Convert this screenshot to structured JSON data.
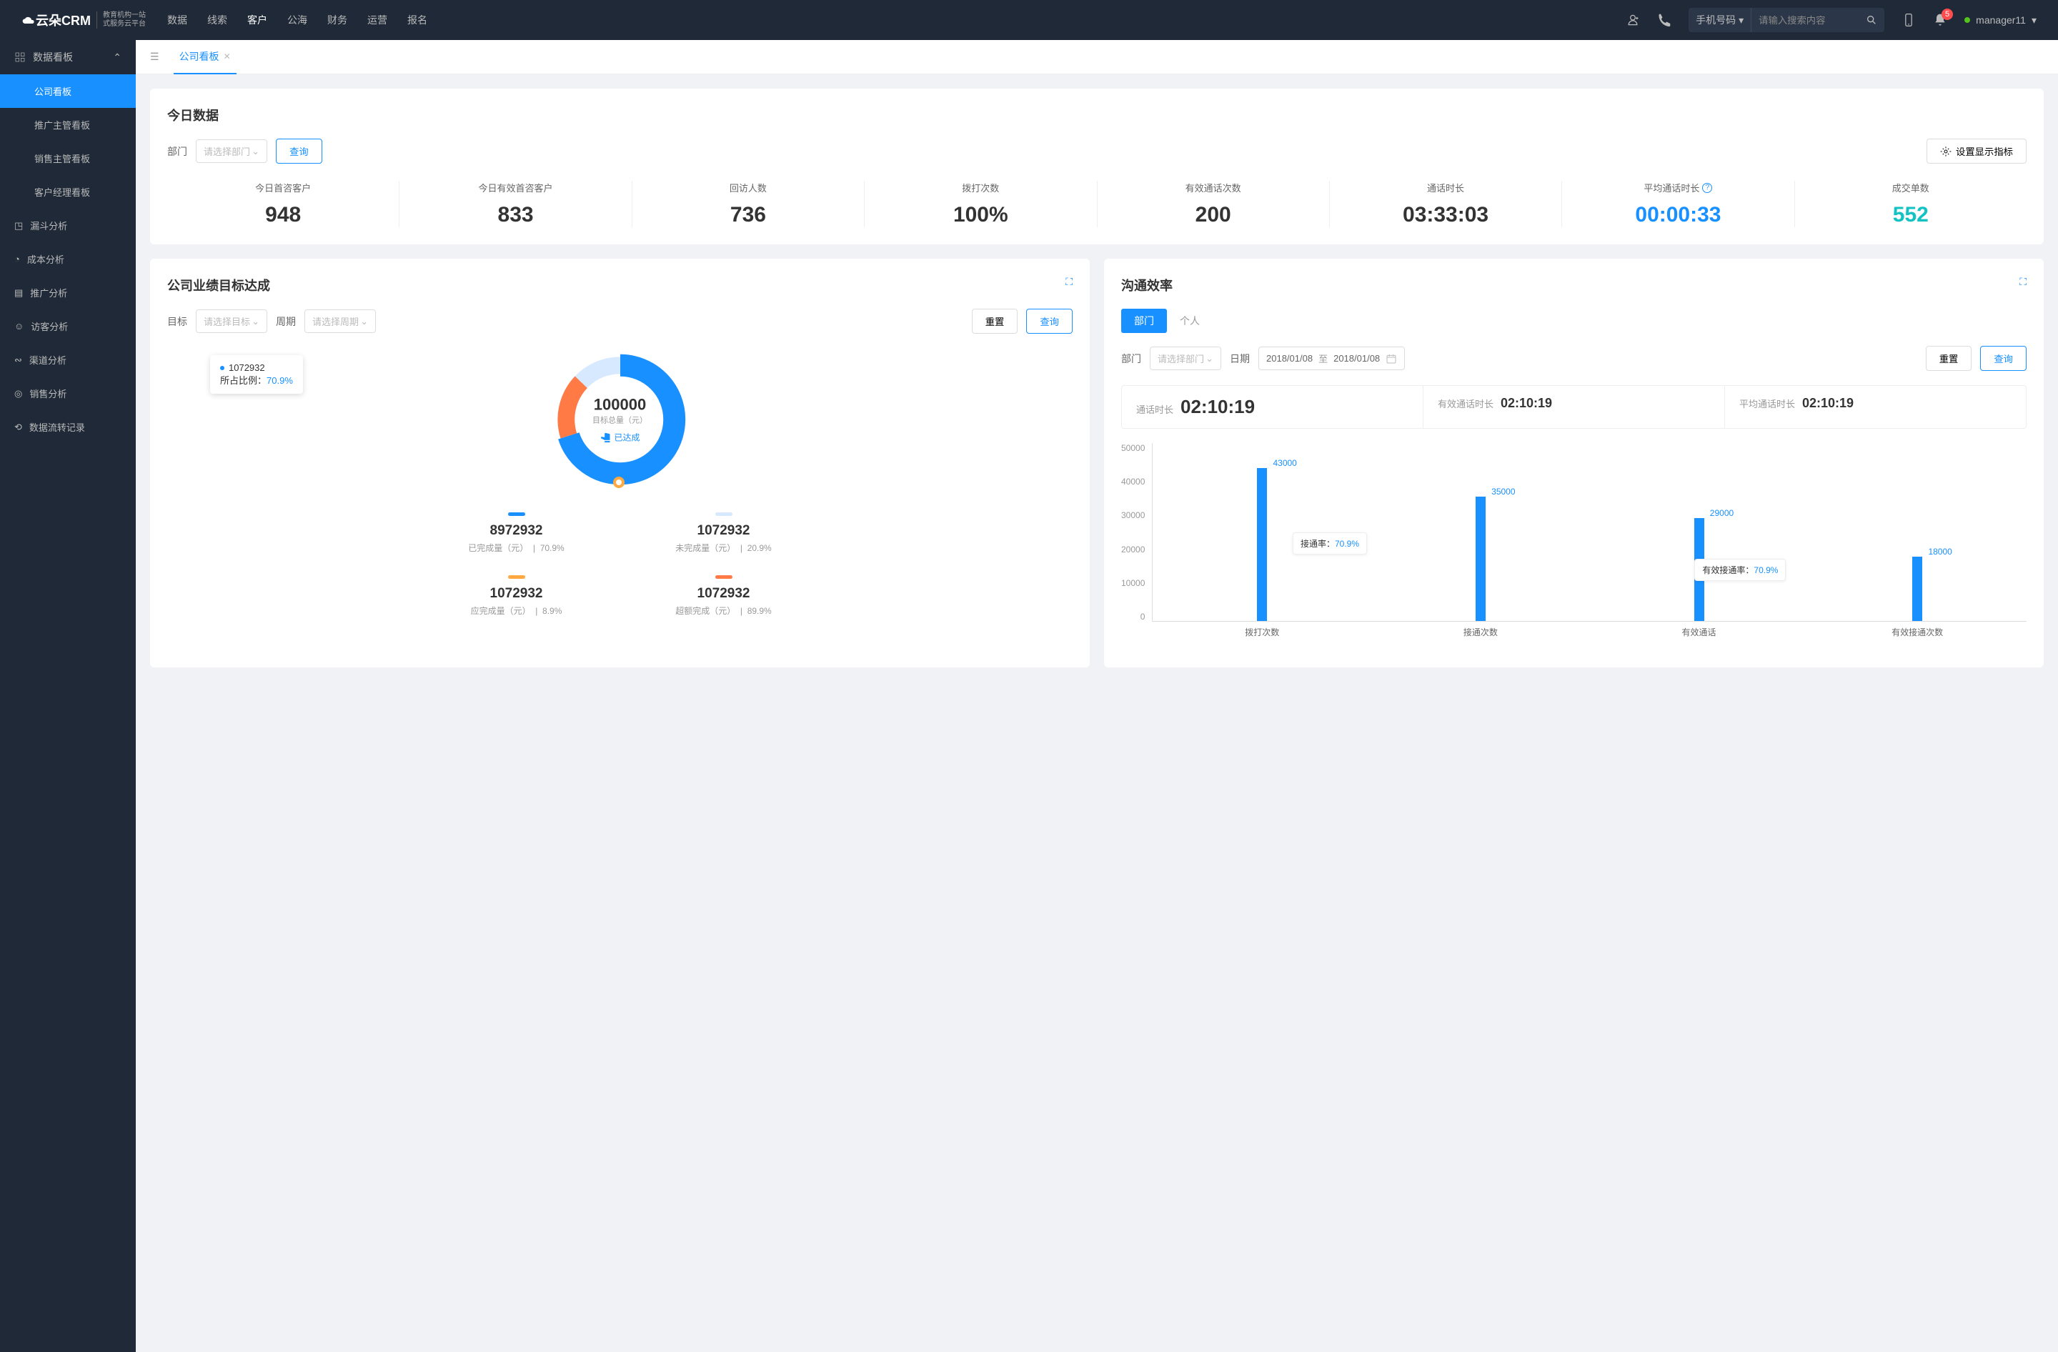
{
  "header": {
    "logo": "云朵CRM",
    "logo_sub1": "教育机构一站",
    "logo_sub2": "式服务云平台",
    "nav": [
      "数据",
      "线索",
      "客户",
      "公海",
      "财务",
      "运营",
      "报名"
    ],
    "nav_active": 2,
    "search_type": "手机号码",
    "search_placeholder": "请输入搜索内容",
    "notif_count": "5",
    "user": "manager11"
  },
  "sidebar": {
    "group_label": "数据看板",
    "items": [
      "公司看板",
      "推广主管看板",
      "销售主管看板",
      "客户经理看板"
    ],
    "active": 0,
    "singles": [
      "漏斗分析",
      "成本分析",
      "推广分析",
      "访客分析",
      "渠道分析",
      "销售分析",
      "数据流转记录"
    ]
  },
  "tab": {
    "label": "公司看板"
  },
  "today": {
    "title": "今日数据",
    "dept_label": "部门",
    "dept_placeholder": "请选择部门",
    "query": "查询",
    "settings": "设置显示指标",
    "metrics": [
      {
        "label": "今日首咨客户",
        "value": "948",
        "cls": ""
      },
      {
        "label": "今日有效首咨客户",
        "value": "833",
        "cls": ""
      },
      {
        "label": "回访人数",
        "value": "736",
        "cls": ""
      },
      {
        "label": "拨打次数",
        "value": "100%",
        "cls": ""
      },
      {
        "label": "有效通话次数",
        "value": "200",
        "cls": ""
      },
      {
        "label": "通话时长",
        "value": "03:33:03",
        "cls": ""
      },
      {
        "label": "平均通话时长",
        "value": "00:00:33",
        "cls": "blue",
        "info": true
      },
      {
        "label": "成交单数",
        "value": "552",
        "cls": "cyan"
      }
    ]
  },
  "goal": {
    "title": "公司业绩目标达成",
    "target_label": "目标",
    "target_placeholder": "请选择目标",
    "period_label": "周期",
    "period_placeholder": "请选择周期",
    "reset": "重置",
    "query": "查询",
    "tooltip_val": "1072932",
    "tooltip_pct_label": "所占比例：",
    "tooltip_pct": "70.9%",
    "center_val": "100000",
    "center_label": "目标总量（元）",
    "center_status": "已达成",
    "legend": [
      {
        "color": "#1890ff",
        "val": "8972932",
        "desc": "已完成量（元）",
        "pct": "70.9%"
      },
      {
        "color": "#d6e9ff",
        "val": "1072932",
        "desc": "未完成量（元）",
        "pct": "20.9%"
      },
      {
        "color": "#ffa940",
        "val": "1072932",
        "desc": "应完成量（元）",
        "pct": "8.9%"
      },
      {
        "color": "#ff7a45",
        "val": "1072932",
        "desc": "超额完成（元）",
        "pct": "89.9%"
      }
    ]
  },
  "comm": {
    "title": "沟通效率",
    "tab_dept": "部门",
    "tab_person": "个人",
    "dept_label": "部门",
    "dept_placeholder": "请选择部门",
    "date_label": "日期",
    "date_from": "2018/01/08",
    "date_to": "2018/01/08",
    "date_sep": "至",
    "reset": "重置",
    "query": "查询",
    "stats": [
      {
        "label": "通话时长",
        "val": "02:10:19",
        "big": true
      },
      {
        "label": "有效通话时长",
        "val": "02:10:19"
      },
      {
        "label": "平均通话时长",
        "val": "02:10:19"
      }
    ],
    "annot1_label": "接通率：",
    "annot1_pct": "70.9%",
    "annot2_label": "有效接通率：",
    "annot2_pct": "70.9%"
  },
  "chart_data": {
    "type": "bar",
    "categories": [
      "拨打次数",
      "接通次数",
      "有效通话",
      "有效接通次数"
    ],
    "values": [
      43000,
      35000,
      29000,
      18000
    ],
    "ylabel": "",
    "xlabel": "",
    "ylim": [
      0,
      50000
    ],
    "yticks": [
      0,
      10000,
      20000,
      30000,
      40000,
      50000
    ]
  }
}
